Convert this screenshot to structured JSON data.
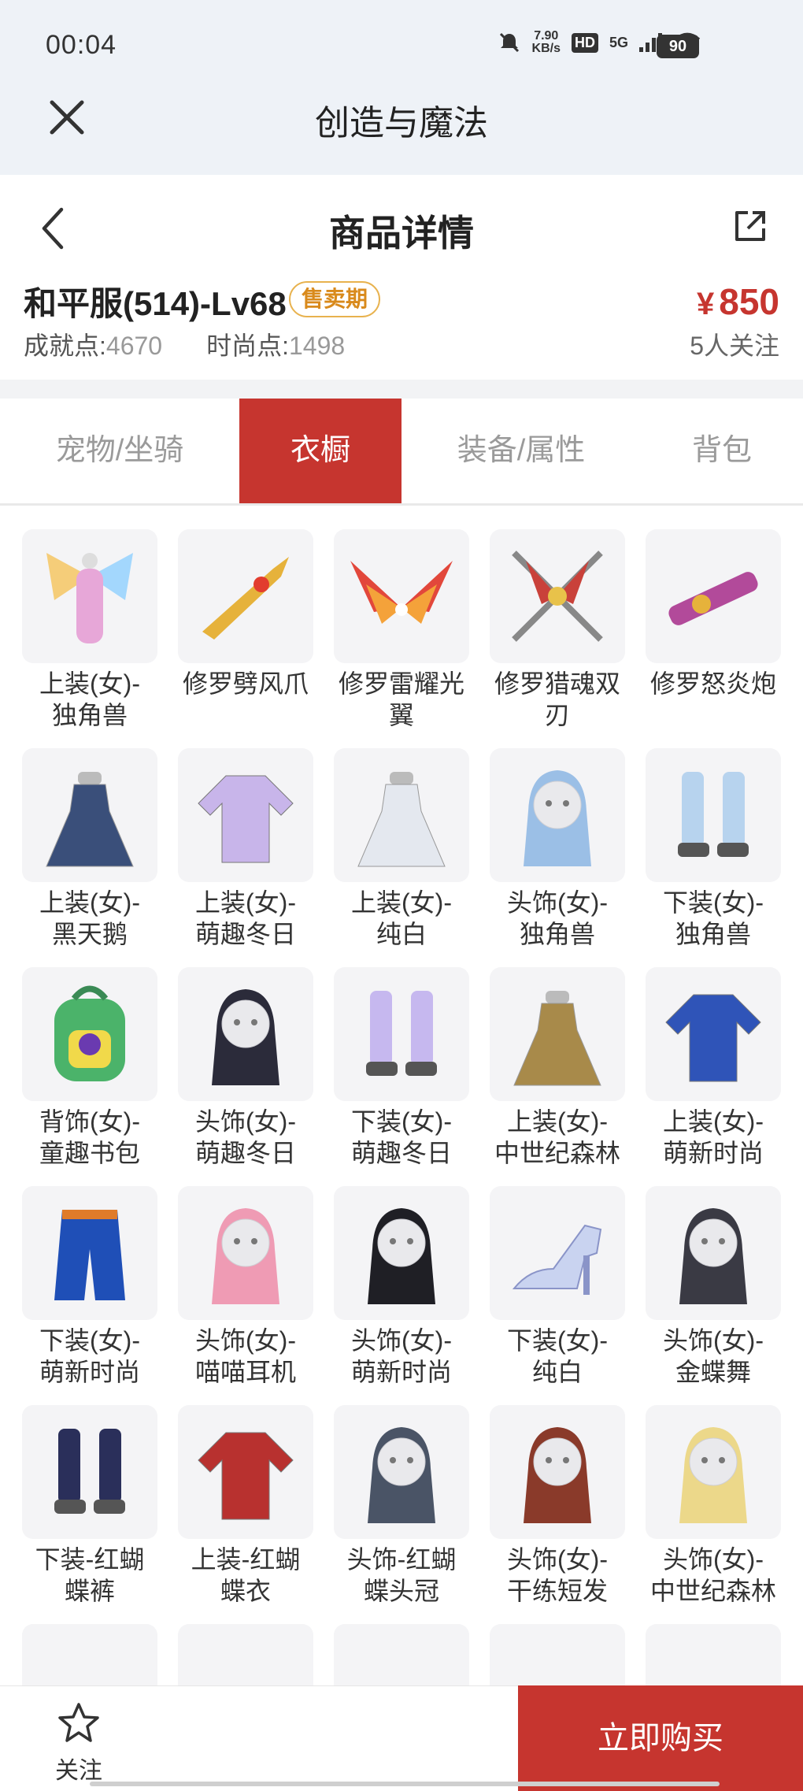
{
  "status_bar": {
    "time": "00:04",
    "speed_value": "7.90",
    "speed_unit": "KB/s",
    "hd_label": "HD",
    "network": "5G",
    "battery": "90"
  },
  "app_header": {
    "title": "创造与魔法",
    "close_icon": "close-icon"
  },
  "detail_header": {
    "title": "商品详情",
    "back_icon": "chevron-left-icon",
    "share_icon": "share-icon"
  },
  "product": {
    "name": "和平服(514)-Lv68",
    "badge": "售卖期",
    "price_currency": "¥",
    "price_value": "850",
    "achievement_label": "成就点:",
    "achievement_value": "4670",
    "fashion_label": "时尚点:",
    "fashion_value": "1498",
    "followers": "5人关注"
  },
  "tabs": [
    {
      "label": "宠物/坐骑",
      "active": false
    },
    {
      "label": "衣橱",
      "active": true
    },
    {
      "label": "装备/属性",
      "active": false
    },
    {
      "label": "背包",
      "active": false
    }
  ],
  "items": [
    {
      "line1": "上装(女)-",
      "line2": "独角兽",
      "icon": "winged-outfit-icon",
      "color": "#e7a7d8"
    },
    {
      "line1": "修罗劈风爪",
      "line2": "",
      "icon": "claw-weapon-icon",
      "color": "#e6b23b"
    },
    {
      "line1": "修罗雷耀光",
      "line2": "翼",
      "icon": "wings-icon",
      "color": "#e2473b"
    },
    {
      "line1": "修罗猎魂双",
      "line2": "刃",
      "icon": "twin-blades-icon",
      "color": "#c9413a"
    },
    {
      "line1": "修罗怒炎炮",
      "line2": "",
      "icon": "cannon-icon",
      "color": "#b24a9a"
    },
    {
      "line1": "上装(女)-",
      "line2": "黑天鹅",
      "icon": "dress-icon",
      "color": "#3a4f7a"
    },
    {
      "line1": "上装(女)-",
      "line2": "萌趣冬日",
      "icon": "jacket-icon",
      "color": "#c8b5ea"
    },
    {
      "line1": "上装(女)-",
      "line2": "纯白",
      "icon": "dress-icon",
      "color": "#e4e8ef"
    },
    {
      "line1": "头饰(女)-",
      "line2": "独角兽",
      "icon": "headwear-icon",
      "color": "#9bbfe6"
    },
    {
      "line1": "下装(女)-",
      "line2": "独角兽",
      "icon": "boots-icon",
      "color": "#b7d3ee"
    },
    {
      "line1": "背饰(女)-",
      "line2": "童趣书包",
      "icon": "backpack-icon",
      "color": "#4bb36a"
    },
    {
      "line1": "头饰(女)-",
      "line2": "萌趣冬日",
      "icon": "headwear-icon",
      "color": "#2b2b3a"
    },
    {
      "line1": "下装(女)-",
      "line2": "萌趣冬日",
      "icon": "boots-icon",
      "color": "#c6b8ef"
    },
    {
      "line1": "上装(女)-",
      "line2": "中世纪森林",
      "icon": "dress-icon",
      "color": "#a88a4a"
    },
    {
      "line1": "上装(女)-",
      "line2": "萌新时尚",
      "icon": "jacket-icon",
      "color": "#2f54b8"
    },
    {
      "line1": "下装(女)-",
      "line2": "萌新时尚",
      "icon": "pants-icon",
      "color": "#1f4fb7"
    },
    {
      "line1": "头饰(女)-",
      "line2": "喵喵耳机",
      "icon": "headwear-icon",
      "color": "#ef9bb4"
    },
    {
      "line1": "头饰(女)-",
      "line2": "萌新时尚",
      "icon": "headwear-icon",
      "color": "#1f1f25"
    },
    {
      "line1": "下装(女)-",
      "line2": "纯白",
      "icon": "high-heel-icon",
      "color": "#c9d3f0"
    },
    {
      "line1": "头饰(女)-",
      "line2": "金蝶舞",
      "icon": "headwear-icon",
      "color": "#3a3a44"
    },
    {
      "line1": "下装-红蝴",
      "line2": "蝶裤",
      "icon": "boots-icon",
      "color": "#2a2f5a"
    },
    {
      "line1": "上装-红蝴",
      "line2": "蝶衣",
      "icon": "jacket-icon",
      "color": "#b8312f"
    },
    {
      "line1": "头饰-红蝴",
      "line2": "蝶头冠",
      "icon": "headwear-icon",
      "color": "#4a5466"
    },
    {
      "line1": "头饰(女)-",
      "line2": "干练短发",
      "icon": "headwear-icon",
      "color": "#8a3a2a"
    },
    {
      "line1": "头饰(女)-",
      "line2": "中世纪森林",
      "icon": "headwear-icon",
      "color": "#ecd88a"
    },
    {
      "line1": "",
      "line2": "",
      "icon": "partial-item-icon",
      "color": "#8a7f84"
    },
    {
      "line1": "",
      "line2": "",
      "icon": "partial-item-icon",
      "color": "#d9a9b0"
    },
    {
      "line1": "",
      "line2": "",
      "icon": "partial-item-icon",
      "color": "#b08a7a"
    },
    {
      "line1": "",
      "line2": "",
      "icon": "partial-item-icon",
      "color": "#e3c24a"
    },
    {
      "line1": "",
      "line2": "",
      "icon": "partial-item-icon",
      "color": "#9b5fd0"
    }
  ],
  "bottom_bar": {
    "follow_label": "关注",
    "buy_label": "立即购买",
    "accent": "#c6352f"
  }
}
